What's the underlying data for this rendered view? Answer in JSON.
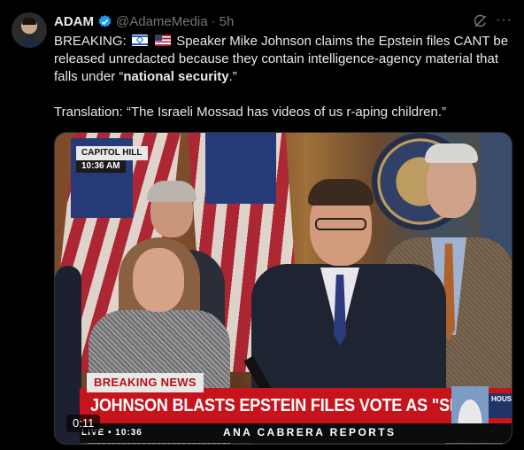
{
  "author": {
    "name": "ADAM",
    "handle": "@AdameMedia",
    "separator": "·",
    "time": "5h",
    "verified_color": "#1d9bf0"
  },
  "actions": {
    "grok_icon": "grok-icon",
    "more_icon": "more-icon",
    "more_label": "···"
  },
  "tweet": {
    "line1_prefix": "BREAKING:",
    "line1_rest": "Speaker Mike Johnson claims the Epstein files CANT be released unredacted because they contain intelligence-agency material that falls under “",
    "line1_bold": "national security",
    "line1_end": ".”",
    "line2": "Translation: “The Israeli Mossad has videos of us r-aping children.”"
  },
  "video": {
    "location": "CAPITOL HILL",
    "clock": "10:36 AM",
    "breaking_label": "BREAKING NEWS",
    "headline": "JOHNSON BLASTS EPSTEIN FILES VOTE AS \"SHOW VOTE\"",
    "corner_label": "HOUS",
    "live_label": "LIVE • 10:36",
    "program": "ANA CABRERA REPORTS",
    "duration": "0:11",
    "banner_color": "#c7141c"
  }
}
